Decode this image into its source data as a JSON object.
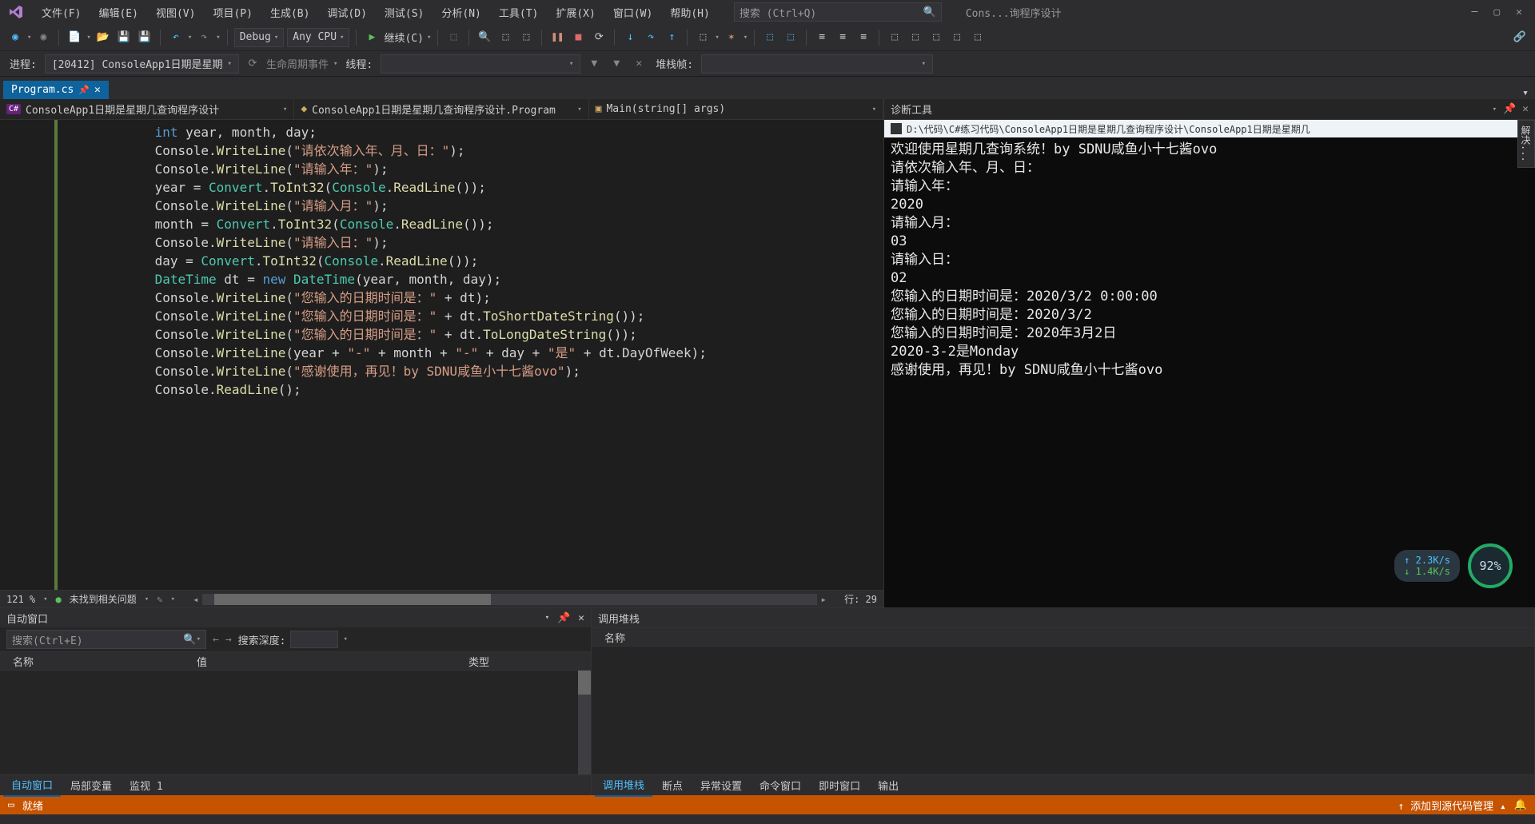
{
  "menu": {
    "file": "文件(F)",
    "edit": "编辑(E)",
    "view": "视图(V)",
    "project": "项目(P)",
    "build": "生成(B)",
    "debug": "调试(D)",
    "test": "测试(S)",
    "analyze": "分析(N)",
    "tools": "工具(T)",
    "ext": "扩展(X)",
    "window": "窗口(W)",
    "help": "帮助(H)"
  },
  "search_placeholder": "搜索 (Ctrl+Q)",
  "title_short": "Cons...询程序设计",
  "toolbar": {
    "config": "Debug",
    "platform": "Any CPU",
    "continue": "继续(C)"
  },
  "toolbar2": {
    "process_label": "进程:",
    "process": "[20412] ConsoleApp1日期是星期",
    "lifecycle": "生命周期事件",
    "thread": "线程:",
    "stackframe": "堆栈帧:"
  },
  "tab": {
    "name": "Program.cs"
  },
  "breadcrumb": {
    "a": "ConsoleApp1日期是星期几查询程序设计",
    "b": "ConsoleApp1日期是星期几查询程序设计.Program",
    "c": "Main(string[] args)"
  },
  "code_lines": [
    [
      {
        "t": "            ",
        "c": ""
      },
      {
        "t": "int",
        "c": "kw"
      },
      {
        "t": " year, month, day;",
        "c": ""
      }
    ],
    [
      {
        "t": "            Console.",
        "c": ""
      },
      {
        "t": "WriteLine",
        "c": "mth"
      },
      {
        "t": "(",
        "c": ""
      },
      {
        "t": "\"请依次输入年、月、日：\"",
        "c": "str"
      },
      {
        "t": ");",
        "c": ""
      }
    ],
    [
      {
        "t": "            Console.",
        "c": ""
      },
      {
        "t": "WriteLine",
        "c": "mth"
      },
      {
        "t": "(",
        "c": ""
      },
      {
        "t": "\"请输入年：\"",
        "c": "str"
      },
      {
        "t": ");",
        "c": ""
      }
    ],
    [
      {
        "t": "            year = ",
        "c": ""
      },
      {
        "t": "Convert",
        "c": "cls"
      },
      {
        "t": ".",
        "c": ""
      },
      {
        "t": "ToInt32",
        "c": "mth"
      },
      {
        "t": "(",
        "c": ""
      },
      {
        "t": "Console",
        "c": "cls"
      },
      {
        "t": ".",
        "c": ""
      },
      {
        "t": "ReadLine",
        "c": "mth"
      },
      {
        "t": "());",
        "c": ""
      }
    ],
    [
      {
        "t": "            Console.",
        "c": ""
      },
      {
        "t": "WriteLine",
        "c": "mth"
      },
      {
        "t": "(",
        "c": ""
      },
      {
        "t": "\"请输入月：\"",
        "c": "str"
      },
      {
        "t": ");",
        "c": ""
      }
    ],
    [
      {
        "t": "            month = ",
        "c": ""
      },
      {
        "t": "Convert",
        "c": "cls"
      },
      {
        "t": ".",
        "c": ""
      },
      {
        "t": "ToInt32",
        "c": "mth"
      },
      {
        "t": "(",
        "c": ""
      },
      {
        "t": "Console",
        "c": "cls"
      },
      {
        "t": ".",
        "c": ""
      },
      {
        "t": "ReadLine",
        "c": "mth"
      },
      {
        "t": "());",
        "c": ""
      }
    ],
    [
      {
        "t": "            Console.",
        "c": ""
      },
      {
        "t": "WriteLine",
        "c": "mth"
      },
      {
        "t": "(",
        "c": ""
      },
      {
        "t": "\"请输入日：\"",
        "c": "str"
      },
      {
        "t": ");",
        "c": ""
      }
    ],
    [
      {
        "t": "            day = ",
        "c": ""
      },
      {
        "t": "Convert",
        "c": "cls"
      },
      {
        "t": ".",
        "c": ""
      },
      {
        "t": "ToInt32",
        "c": "mth"
      },
      {
        "t": "(",
        "c": ""
      },
      {
        "t": "Console",
        "c": "cls"
      },
      {
        "t": ".",
        "c": ""
      },
      {
        "t": "ReadLine",
        "c": "mth"
      },
      {
        "t": "());",
        "c": ""
      }
    ],
    [
      {
        "t": "            ",
        "c": ""
      },
      {
        "t": "DateTime",
        "c": "cls"
      },
      {
        "t": " dt = ",
        "c": ""
      },
      {
        "t": "new",
        "c": "kw"
      },
      {
        "t": " ",
        "c": ""
      },
      {
        "t": "DateTime",
        "c": "cls"
      },
      {
        "t": "(year, month, day);",
        "c": ""
      }
    ],
    [
      {
        "t": "            Console.",
        "c": ""
      },
      {
        "t": "WriteLine",
        "c": "mth"
      },
      {
        "t": "(",
        "c": ""
      },
      {
        "t": "\"您输入的日期时间是：\"",
        "c": "str"
      },
      {
        "t": " + dt);",
        "c": ""
      }
    ],
    [
      {
        "t": "            Console.",
        "c": ""
      },
      {
        "t": "WriteLine",
        "c": "mth"
      },
      {
        "t": "(",
        "c": ""
      },
      {
        "t": "\"您输入的日期时间是：\"",
        "c": "str"
      },
      {
        "t": " + dt.",
        "c": ""
      },
      {
        "t": "ToShortDateString",
        "c": "mth"
      },
      {
        "t": "());",
        "c": ""
      }
    ],
    [
      {
        "t": "            Console.",
        "c": ""
      },
      {
        "t": "WriteLine",
        "c": "mth"
      },
      {
        "t": "(",
        "c": ""
      },
      {
        "t": "\"您输入的日期时间是：\"",
        "c": "str"
      },
      {
        "t": " + dt.",
        "c": ""
      },
      {
        "t": "ToLongDateString",
        "c": "mth"
      },
      {
        "t": "());",
        "c": ""
      }
    ],
    [
      {
        "t": "            Console.",
        "c": ""
      },
      {
        "t": "WriteLine",
        "c": "mth"
      },
      {
        "t": "(year + ",
        "c": ""
      },
      {
        "t": "\"-\"",
        "c": "str"
      },
      {
        "t": " + month + ",
        "c": ""
      },
      {
        "t": "\"-\"",
        "c": "str"
      },
      {
        "t": " + day + ",
        "c": ""
      },
      {
        "t": "\"是\"",
        "c": "str"
      },
      {
        "t": " + dt.DayOfWeek);",
        "c": ""
      }
    ],
    [
      {
        "t": "            Console.",
        "c": ""
      },
      {
        "t": "WriteLine",
        "c": "mth"
      },
      {
        "t": "(",
        "c": ""
      },
      {
        "t": "\"感谢使用，再见！by SDNU咸鱼小十七酱ovo\"",
        "c": "str"
      },
      {
        "t": ");",
        "c": ""
      }
    ],
    [
      {
        "t": "            Console.",
        "c": ""
      },
      {
        "t": "ReadLine",
        "c": "mth"
      },
      {
        "t": "();",
        "c": ""
      }
    ]
  ],
  "editor_footer": {
    "zoom": "121 %",
    "issues": "未找到相关问题",
    "lineinfo": "行: 29"
  },
  "diag_title": "诊断工具",
  "console_path": "D:\\代码\\C#练习代码\\ConsoleApp1日期是星期几查询程序设计\\ConsoleApp1日期是星期几",
  "console_output": "欢迎使用星期几查询系统！by SDNU咸鱼小十七酱ovo\n请依次输入年、月、日：\n请输入年：\n2020\n请输入月：\n03\n请输入日：\n02\n您输入的日期时间是：2020/3/2 0:00:00\n您输入的日期时间是：2020/3/2\n您输入的日期时间是：2020年3月2日\n2020-3-2是Monday\n感谢使用，再见！by SDNU咸鱼小十七酱ovo",
  "side_tab": "解决...",
  "auto": {
    "title": "自动窗口",
    "search": "搜索(Ctrl+E)",
    "depth": "搜索深度:",
    "col_name": "名称",
    "col_value": "值",
    "col_type": "类型"
  },
  "auto_tabs": {
    "auto": "自动窗口",
    "locals": "局部变量",
    "watch": "监视 1"
  },
  "callstack": {
    "title": "调用堆栈",
    "col_name": "名称"
  },
  "cs_tabs": {
    "cs": "调用堆栈",
    "bp": "断点",
    "ex": "异常设置",
    "cmd": "命令窗口",
    "im": "即时窗口",
    "out": "输出"
  },
  "status": {
    "ready": "就绪",
    "source": "添加到源代码管理"
  },
  "net": {
    "up": "↑ 2.3K/s",
    "dn": "↓ 1.4K/s",
    "pct": "92%"
  }
}
